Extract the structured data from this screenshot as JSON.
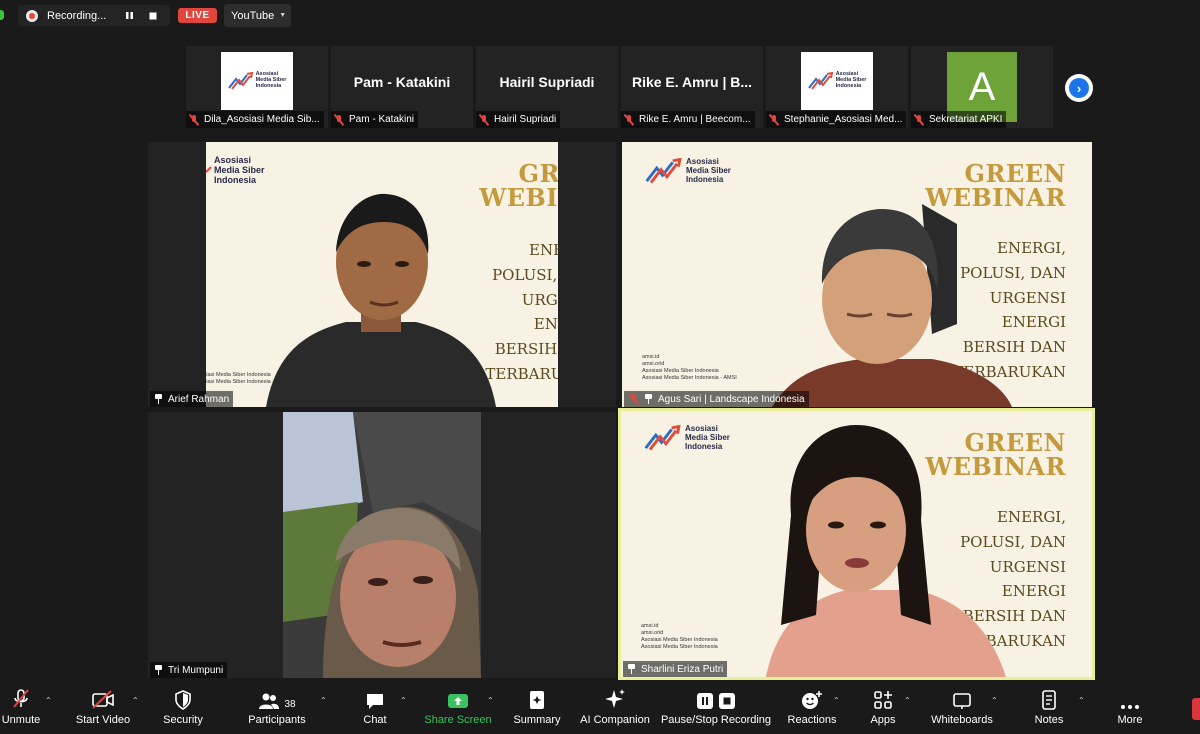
{
  "recording": {
    "status_text": "Recording...",
    "pause_icon": "pause-icon",
    "stop_icon": "stop-icon"
  },
  "live": {
    "badge": "LIVE",
    "stream_target": "YouTube"
  },
  "thumbnails": [
    {
      "name": "",
      "label": "Dila_Asosiasi Media Sib...",
      "type": "logo"
    },
    {
      "name": "Pam - Katakini",
      "label": "Pam - Katakini",
      "type": "name"
    },
    {
      "name": "Hairil Supriadi",
      "label": "Hairil Supriadi",
      "type": "name"
    },
    {
      "name": "Rike E. Amru | B...",
      "label": "Rike E. Amru | Beecom...",
      "type": "name"
    },
    {
      "name": "",
      "label": "Stephanie_Asosiasi Med...",
      "type": "logo"
    },
    {
      "name": "A",
      "label": "Sekretariat APKI",
      "type": "avatar"
    }
  ],
  "logo": {
    "line1": "Asosiasi",
    "line2": "Media Siber",
    "line3": "Indonesia"
  },
  "slide": {
    "title1": "GREEN",
    "title2": "WEBINAR",
    "body": [
      "ENERGI,",
      "POLUSI, DAN",
      "URGENSI",
      "ENERGI",
      "BERSIH DAN",
      "TERBARUKAN"
    ],
    "social": [
      "amsi.id",
      "amsi.orid",
      "Asosiasi Media Siber Indonesia",
      "Asosiasi Media Siber Indonesia - AMSI"
    ]
  },
  "tiles": [
    {
      "label": "Arief Rahman"
    },
    {
      "label": "Agus Sari | Landscape Indonesia"
    },
    {
      "label": "Tri Mumpuni"
    },
    {
      "label": "Sharlini Eriza Putri"
    }
  ],
  "toolbar": {
    "unmute": "Unmute",
    "start_video": "Start Video",
    "security": "Security",
    "participants": "Participants",
    "participants_count": "38",
    "chat": "Chat",
    "share_screen": "Share Screen",
    "summary": "Summary",
    "ai_companion": "AI Companion",
    "pause_stop_recording": "Pause/Stop Recording",
    "reactions": "Reactions",
    "apps": "Apps",
    "whiteboards": "Whiteboards",
    "notes": "Notes",
    "more": "More"
  },
  "colors": {
    "accent_blue": "#1e75e8",
    "live_red": "#e0463e",
    "share_green": "#39c35f",
    "active_speaker": "#e8ef96",
    "slide_gold": "#c49a3c"
  }
}
